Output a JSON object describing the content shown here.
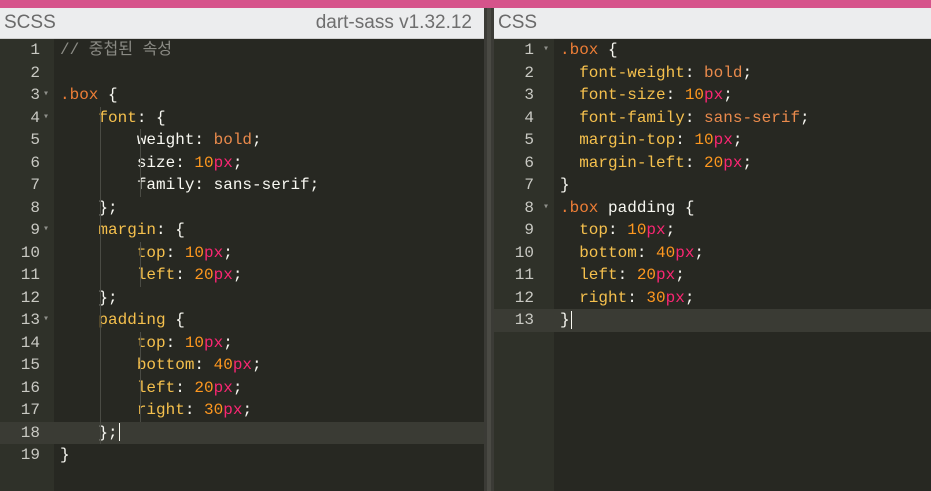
{
  "panes": {
    "scss": {
      "title": "SCSS",
      "version": "dart-sass v1.32.12"
    },
    "css": {
      "title": "CSS"
    }
  },
  "scss_lines": [
    {
      "n": "1",
      "fold": false,
      "tokens": [
        [
          "t-cmt",
          "// 중첩된 속성"
        ]
      ]
    },
    {
      "n": "2",
      "fold": false,
      "tokens": []
    },
    {
      "n": "3",
      "fold": true,
      "tokens": [
        [
          "t-cls",
          ".box"
        ],
        [
          "t-punc",
          " {"
        ]
      ]
    },
    {
      "n": "4",
      "fold": true,
      "tokens": [
        [
          "t-plain",
          "    "
        ],
        [
          "t-prop",
          "font"
        ],
        [
          "t-punc",
          ": {"
        ]
      ]
    },
    {
      "n": "5",
      "fold": false,
      "tokens": [
        [
          "t-plain",
          "        weight"
        ],
        [
          "t-punc",
          ": "
        ],
        [
          "t-val",
          "bold"
        ],
        [
          "t-punc",
          ";"
        ]
      ]
    },
    {
      "n": "6",
      "fold": false,
      "tokens": [
        [
          "t-plain",
          "        size"
        ],
        [
          "t-punc",
          ": "
        ],
        [
          "t-num",
          "10"
        ],
        [
          "t-unit",
          "px"
        ],
        [
          "t-punc",
          ";"
        ]
      ]
    },
    {
      "n": "7",
      "fold": false,
      "tokens": [
        [
          "t-plain",
          "        family"
        ],
        [
          "t-punc",
          ": "
        ],
        [
          "t-plain",
          "sans-serif"
        ],
        [
          "t-punc",
          ";"
        ]
      ]
    },
    {
      "n": "8",
      "fold": false,
      "tokens": [
        [
          "t-punc",
          "    };"
        ]
      ]
    },
    {
      "n": "9",
      "fold": true,
      "tokens": [
        [
          "t-plain",
          "    "
        ],
        [
          "t-prop",
          "margin"
        ],
        [
          "t-punc",
          ": {"
        ]
      ]
    },
    {
      "n": "10",
      "fold": false,
      "tokens": [
        [
          "t-plain",
          "        "
        ],
        [
          "t-prop",
          "top"
        ],
        [
          "t-punc",
          ": "
        ],
        [
          "t-num",
          "10"
        ],
        [
          "t-unit",
          "px"
        ],
        [
          "t-punc",
          ";"
        ]
      ]
    },
    {
      "n": "11",
      "fold": false,
      "tokens": [
        [
          "t-plain",
          "        "
        ],
        [
          "t-prop",
          "left"
        ],
        [
          "t-punc",
          ": "
        ],
        [
          "t-num",
          "20"
        ],
        [
          "t-unit",
          "px"
        ],
        [
          "t-punc",
          ";"
        ]
      ]
    },
    {
      "n": "12",
      "fold": false,
      "tokens": [
        [
          "t-punc",
          "    };"
        ]
      ]
    },
    {
      "n": "13",
      "fold": true,
      "tokens": [
        [
          "t-plain",
          "    "
        ],
        [
          "t-prop",
          "padding"
        ],
        [
          "t-punc",
          " {"
        ]
      ]
    },
    {
      "n": "14",
      "fold": false,
      "tokens": [
        [
          "t-plain",
          "        "
        ],
        [
          "t-prop",
          "top"
        ],
        [
          "t-punc",
          ": "
        ],
        [
          "t-num",
          "10"
        ],
        [
          "t-unit",
          "px"
        ],
        [
          "t-punc",
          ";"
        ]
      ]
    },
    {
      "n": "15",
      "fold": false,
      "tokens": [
        [
          "t-plain",
          "        "
        ],
        [
          "t-prop",
          "bottom"
        ],
        [
          "t-punc",
          ": "
        ],
        [
          "t-num",
          "40"
        ],
        [
          "t-unit",
          "px"
        ],
        [
          "t-punc",
          ";"
        ]
      ]
    },
    {
      "n": "16",
      "fold": false,
      "tokens": [
        [
          "t-plain",
          "        "
        ],
        [
          "t-prop",
          "left"
        ],
        [
          "t-punc",
          ": "
        ],
        [
          "t-num",
          "20"
        ],
        [
          "t-unit",
          "px"
        ],
        [
          "t-punc",
          ";"
        ]
      ]
    },
    {
      "n": "17",
      "fold": false,
      "tokens": [
        [
          "t-plain",
          "        "
        ],
        [
          "t-prop",
          "right"
        ],
        [
          "t-punc",
          ": "
        ],
        [
          "t-num",
          "30"
        ],
        [
          "t-unit",
          "px"
        ],
        [
          "t-punc",
          ";"
        ]
      ]
    },
    {
      "n": "18",
      "fold": false,
      "active": true,
      "cursor": true,
      "tokens": [
        [
          "t-punc",
          "    };"
        ]
      ]
    },
    {
      "n": "19",
      "fold": false,
      "tokens": [
        [
          "t-punc",
          "}"
        ]
      ]
    }
  ],
  "css_lines": [
    {
      "n": "1",
      "fold": true,
      "tokens": [
        [
          "t-cls",
          ".box"
        ],
        [
          "t-punc",
          " {"
        ]
      ]
    },
    {
      "n": "2",
      "fold": false,
      "tokens": [
        [
          "t-plain",
          "  "
        ],
        [
          "t-prop",
          "font-weight"
        ],
        [
          "t-punc",
          ": "
        ],
        [
          "t-val",
          "bold"
        ],
        [
          "t-punc",
          ";"
        ]
      ]
    },
    {
      "n": "3",
      "fold": false,
      "tokens": [
        [
          "t-plain",
          "  "
        ],
        [
          "t-prop",
          "font-size"
        ],
        [
          "t-punc",
          ": "
        ],
        [
          "t-num",
          "10"
        ],
        [
          "t-unit",
          "px"
        ],
        [
          "t-punc",
          ";"
        ]
      ]
    },
    {
      "n": "4",
      "fold": false,
      "tokens": [
        [
          "t-plain",
          "  "
        ],
        [
          "t-prop",
          "font-family"
        ],
        [
          "t-punc",
          ": "
        ],
        [
          "t-val",
          "sans-serif"
        ],
        [
          "t-punc",
          ";"
        ]
      ]
    },
    {
      "n": "5",
      "fold": false,
      "tokens": [
        [
          "t-plain",
          "  "
        ],
        [
          "t-prop",
          "margin-top"
        ],
        [
          "t-punc",
          ": "
        ],
        [
          "t-num",
          "10"
        ],
        [
          "t-unit",
          "px"
        ],
        [
          "t-punc",
          ";"
        ]
      ]
    },
    {
      "n": "6",
      "fold": false,
      "tokens": [
        [
          "t-plain",
          "  "
        ],
        [
          "t-prop",
          "margin-left"
        ],
        [
          "t-punc",
          ": "
        ],
        [
          "t-num",
          "20"
        ],
        [
          "t-unit",
          "px"
        ],
        [
          "t-punc",
          ";"
        ]
      ]
    },
    {
      "n": "7",
      "fold": false,
      "tokens": [
        [
          "t-punc",
          "}"
        ]
      ]
    },
    {
      "n": "8",
      "fold": true,
      "tokens": [
        [
          "t-cls",
          ".box"
        ],
        [
          "t-plain",
          " padding "
        ],
        [
          "t-punc",
          "{"
        ]
      ]
    },
    {
      "n": "9",
      "fold": false,
      "tokens": [
        [
          "t-plain",
          "  "
        ],
        [
          "t-prop",
          "top"
        ],
        [
          "t-punc",
          ": "
        ],
        [
          "t-num",
          "10"
        ],
        [
          "t-unit",
          "px"
        ],
        [
          "t-punc",
          ";"
        ]
      ]
    },
    {
      "n": "10",
      "fold": false,
      "tokens": [
        [
          "t-plain",
          "  "
        ],
        [
          "t-prop",
          "bottom"
        ],
        [
          "t-punc",
          ": "
        ],
        [
          "t-num",
          "40"
        ],
        [
          "t-unit",
          "px"
        ],
        [
          "t-punc",
          ";"
        ]
      ]
    },
    {
      "n": "11",
      "fold": false,
      "tokens": [
        [
          "t-plain",
          "  "
        ],
        [
          "t-prop",
          "left"
        ],
        [
          "t-punc",
          ": "
        ],
        [
          "t-num",
          "20"
        ],
        [
          "t-unit",
          "px"
        ],
        [
          "t-punc",
          ";"
        ]
      ]
    },
    {
      "n": "12",
      "fold": false,
      "tokens": [
        [
          "t-plain",
          "  "
        ],
        [
          "t-prop",
          "right"
        ],
        [
          "t-punc",
          ": "
        ],
        [
          "t-num",
          "30"
        ],
        [
          "t-unit",
          "px"
        ],
        [
          "t-punc",
          ";"
        ]
      ]
    },
    {
      "n": "13",
      "fold": false,
      "active": true,
      "cursor": true,
      "tokens": [
        [
          "t-punc",
          "}"
        ]
      ]
    }
  ],
  "colors": {
    "accent_bar": "#d6538b",
    "editor_bg": "#272822",
    "gutter_bg": "#2f3129",
    "header_bg": "#ecedee"
  }
}
